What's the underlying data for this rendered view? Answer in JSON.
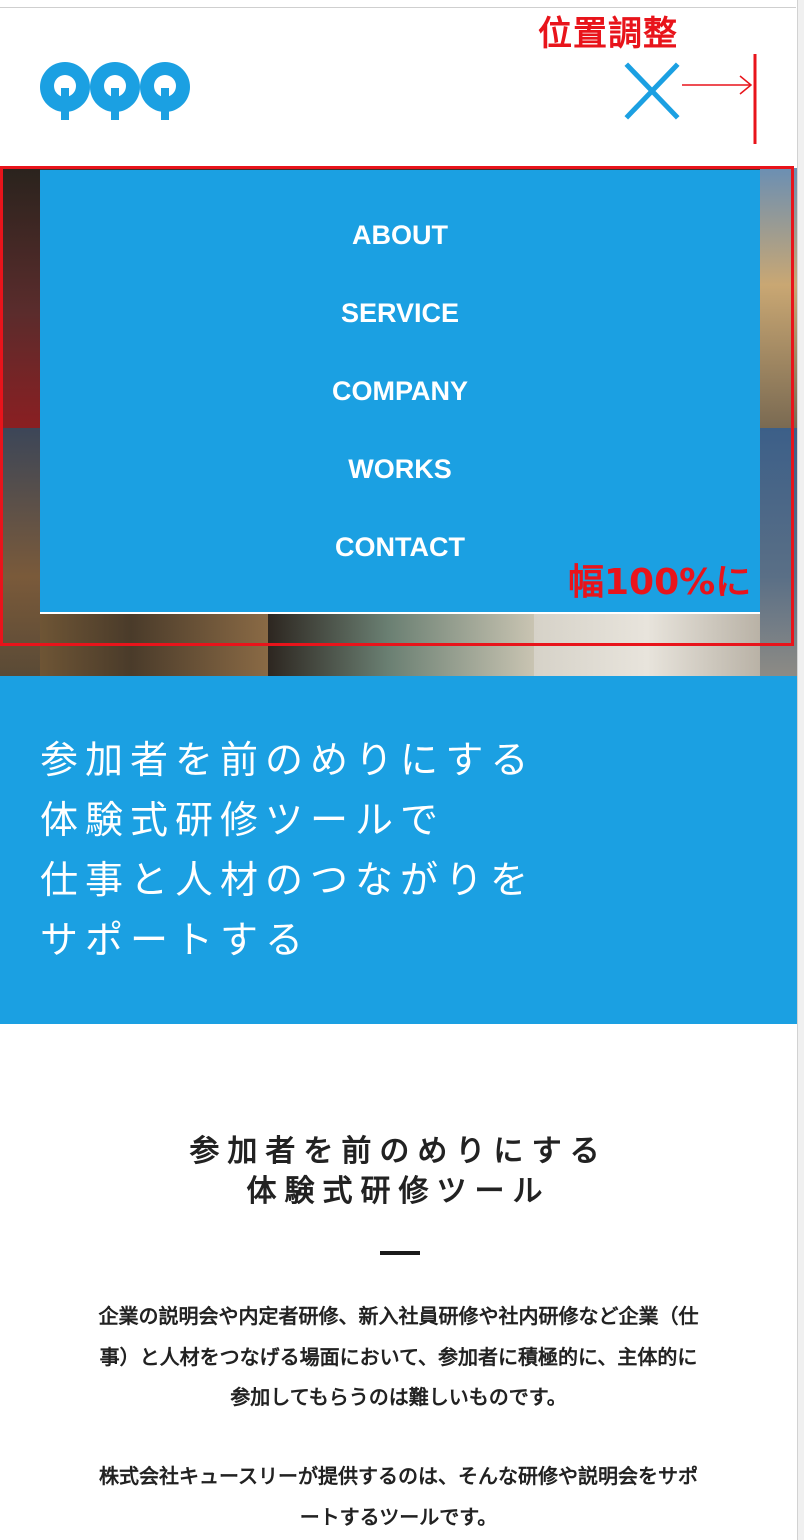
{
  "header": {
    "logo_alt": "QQQ",
    "close_label": "×"
  },
  "annotations": {
    "position_adjust": "位置調整",
    "full_width": "幅100%に"
  },
  "nav": {
    "items": [
      {
        "label": "ABOUT"
      },
      {
        "label": "SERVICE"
      },
      {
        "label": "COMPANY"
      },
      {
        "label": "WORKS"
      },
      {
        "label": "CONTACT"
      }
    ]
  },
  "catch_copy": {
    "lines": [
      "参加者を前のめりにする",
      "体験式研修ツールで",
      "仕事と人材のつながりを",
      "サポートする"
    ]
  },
  "intro": {
    "heading_lines": [
      "参加者を前のめりにする",
      "体験式研修ツール"
    ],
    "paragraph_lines": [
      "企業の説明会や内定者研修、新入社員研修や社内研修など企業（仕",
      "事）と人材をつなげる場面において、参加者に積極的に、主体的に",
      "参加してもらうのは難しいものです。",
      "株式会社キュースリーが提供するのは、そんな研修や説明会をサポ",
      "ートするツールです。"
    ]
  },
  "colors": {
    "brand_blue": "#1ba0e2",
    "annotation_red": "#e8141b",
    "text_dark": "#222222"
  }
}
